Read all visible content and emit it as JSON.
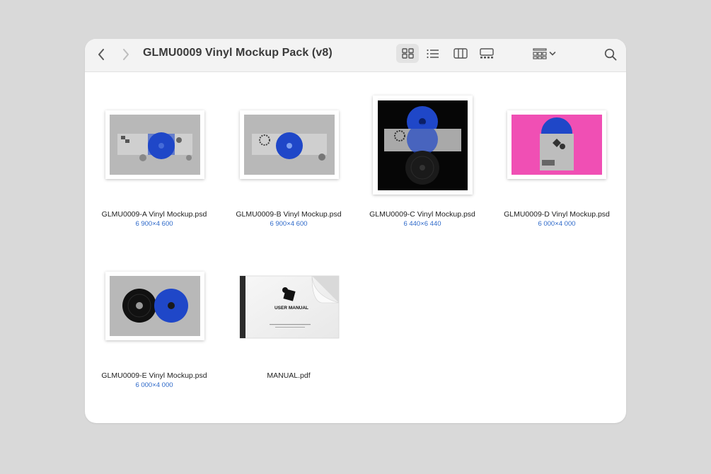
{
  "window": {
    "title": "GLMU0009 Vinyl Mockup Pack (v8)",
    "nav": {
      "back": "chevron-left-icon",
      "forward": "chevron-right-icon"
    },
    "views": [
      "icon-view-icon",
      "list-view-icon",
      "column-view-icon",
      "gallery-view-icon"
    ],
    "group_menu": "group-by-icon",
    "search": "search-icon"
  },
  "files": [
    {
      "name": "GLMU0009-A Vinyl Mockup.psd",
      "dims": "6 900×4 600"
    },
    {
      "name": "GLMU0009-B Vinyl Mockup.psd",
      "dims": "6 900×4 600"
    },
    {
      "name": "GLMU0009-C Vinyl Mockup.psd",
      "dims": "6 440×6 440"
    },
    {
      "name": "GLMU0009-D Vinyl Mockup.psd",
      "dims": "6 000×4 000"
    },
    {
      "name": "GLMU0009-E Vinyl Mockup.psd",
      "dims": "6 000×4 000"
    },
    {
      "name": "MANUAL.pdf",
      "dims": ""
    }
  ],
  "manual_cover": {
    "label": "USER MANUAL"
  },
  "colors": {
    "accent": "#2e69c9",
    "vinyl_blue": "#1f47c8",
    "pink": "#f04fb4"
  }
}
